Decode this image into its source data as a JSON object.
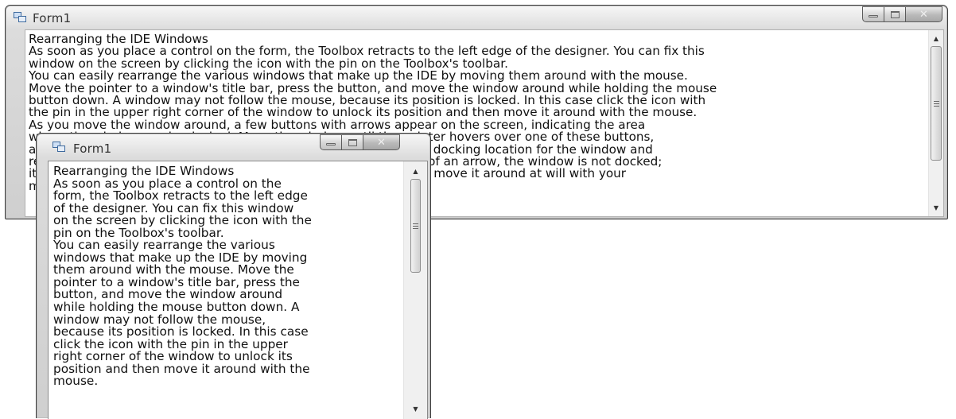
{
  "back_window": {
    "title": "Form1",
    "text_lines": [
      "Rearranging the IDE Windows",
      "As soon as you place a control on the form, the Toolbox retracts to the left edge of the designer. You can fix this",
      "window on the screen by clicking the icon with the pin on the Toolbox's toolbar.",
      "You can easily rearrange the various windows that make up the IDE by moving them around with the mouse.",
      "Move the pointer to a window's title bar, press the button, and move the window around while holding the mouse",
      "button down. A window may not follow the mouse, because its position is locked. In this case click the icon with",
      "the pin in the upper right corner of the window to unlock its position and then move it around with the mouse.",
      "As you move the window around, a few buttons with arrows appear on the screen, indicating the area",
      "where the window can be docked. Move the window until the pointer hovers over one of these buttons,",
      "and the docking area will be shaded in blue color. Find the desired docking location for the window and",
      "release the mouse button. If you release the pointer is not on top of an arrow, the window is not docked;",
      "it remains where you released it as a floating window and you can move it around at will with your",
      "mouse."
    ]
  },
  "front_window": {
    "title": "Form1",
    "text_lines": [
      "Rearranging the IDE Windows",
      "As soon as you place a control on the",
      "form, the Toolbox retracts to the left edge",
      "of the designer. You can fix this window",
      "on the screen by clicking the icon with the",
      "pin on the Toolbox's toolbar.",
      "You can easily rearrange the various",
      "windows that make up the IDE by moving",
      "them around with the mouse. Move the",
      "pointer to a window's title bar, press the",
      "button, and move the window around",
      "while holding the mouse button down. A",
      "window may not follow the mouse,",
      "because its position is locked. In this case",
      "click the icon with the pin in the upper",
      "right corner of the window to unlock its",
      "position and then move it around with the",
      "mouse."
    ]
  },
  "colors": {
    "desktop": "#ffffff",
    "window_frame": "#d0d0d0",
    "text": "#111111"
  },
  "icons": {
    "app": "form-app-icon",
    "minimize": "minimize-icon",
    "maximize": "maximize-icon",
    "close": "close-icon",
    "scroll_up": "scroll-up-arrow-icon",
    "scroll_down": "scroll-down-arrow-icon"
  }
}
